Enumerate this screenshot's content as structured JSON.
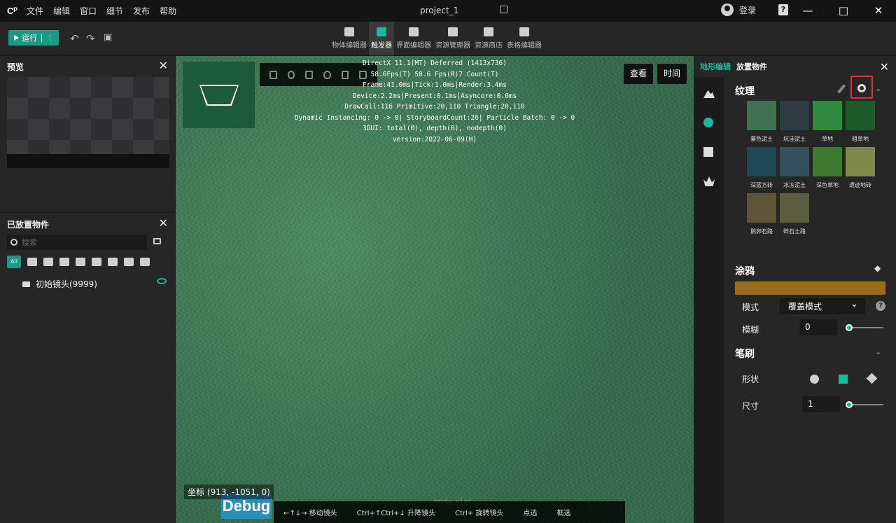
{
  "app": {
    "logo": "Cᴾ",
    "title": "project_1",
    "menu": [
      "文件",
      "编辑",
      "窗口",
      "细节",
      "发布",
      "帮助"
    ],
    "login": "登录",
    "window_controls": [
      "—",
      "□",
      "✕"
    ]
  },
  "toolbar": {
    "run_label": "运行",
    "tabs": [
      "物体编辑器",
      "触发器",
      "界面编辑器",
      "资源管理器",
      "资源商店",
      "表格编辑器"
    ],
    "active_tab": "触发器"
  },
  "left": {
    "preview_title": "预览",
    "placed_title": "已放置物件",
    "search_placeholder": "搜索",
    "filter_all": "All",
    "item": "初始镜头(9999)"
  },
  "viewport": {
    "stats": [
      "DirectX 11.1(MT) Deferred (1413x736)",
      "58.6Fps(T) 58.6 Fps(R)7 Count(T)",
      "Frame:41.0ms|Tick:1.0ms|Render:3.4ms",
      "Device:2.2ms|Present:0.1ms|Asyncore:0.0ms",
      "DrawCall:116 Primitive:20,110 Triangle:20,110",
      "Dynamic Instancing: 0 -> 0| StoryboardCount:26| Particle Batch: 0 -> 0",
      "3DUI: total(0), depth(0), nodepth(0)",
      "version:2022-06-09(H)"
    ],
    "btn_view": "查看",
    "btn_time": "时间",
    "coord": "坐标  (913, -1051, 0)",
    "debug": "Debug",
    "empty_label": "empty_plat",
    "hints": [
      "←↑↓→ 移动镜头",
      "Ctrl+↑Ctrl+↓ 升降镜头",
      "Ctrl+  旋转镜头",
      "  点选",
      "  框选"
    ]
  },
  "right": {
    "tab_terrain": "地形编辑",
    "tab_place": "放置物件",
    "texture_title": "纹理",
    "textures": [
      {
        "label": "薹色泥土",
        "color": "#3f7050"
      },
      {
        "label": "坑洼泥土",
        "color": "#2e3d44"
      },
      {
        "label": "草地",
        "color": "#2f8a3e"
      },
      {
        "label": "粗草地",
        "color": "#1d5a2c"
      },
      {
        "label": "深蓝方砖",
        "color": "#1f4a55"
      },
      {
        "label": "冰冻泥土",
        "color": "#34505c"
      },
      {
        "label": "深色草地",
        "color": "#3d7a2e"
      },
      {
        "label": "遗迹地砖",
        "color": "#7f8a4a"
      },
      {
        "label": "鹅卵石路",
        "color": "#5e5436"
      },
      {
        "label": "碎石土路",
        "color": "#5a5e3c"
      }
    ],
    "paint_title": "涂鸦",
    "paint_color": "#9a6a1e",
    "mode_label": "模式",
    "mode_value": "覆盖模式",
    "blur_label": "模糊",
    "blur_value": "0",
    "brush_title": "笔刷",
    "shape_label": "形状",
    "size_label": "尺寸",
    "size_value": "1"
  }
}
